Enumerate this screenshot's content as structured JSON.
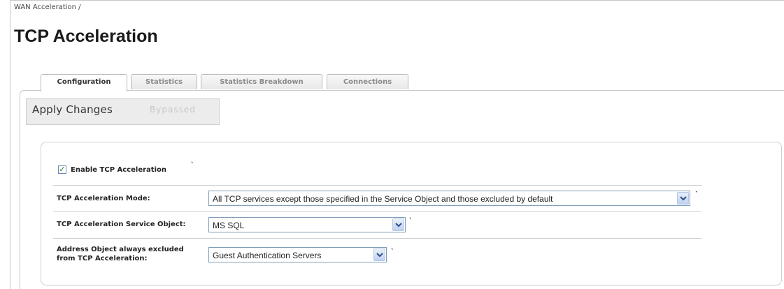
{
  "breadcrumb": "WAN Acceleration /",
  "page_title": "TCP Acceleration",
  "tabs": [
    {
      "label": "Configuration",
      "active": true
    },
    {
      "label": "Statistics",
      "active": false
    },
    {
      "label": "Statistics Breakdown",
      "active": false
    },
    {
      "label": "Connections",
      "active": false
    }
  ],
  "toolbar": {
    "apply_label": "Apply Changes",
    "bypassed_label": "Bypassed"
  },
  "settings": {
    "enable_label": "Enable TCP Acceleration",
    "enable_checked": true,
    "mode_label": "TCP Acceleration Mode:",
    "mode_value": "All TCP services except those specified in the Service Object and those excluded by default",
    "service_object_label": "TCP Acceleration Service Object:",
    "service_object_value": "MS SQL",
    "excluded_label_line1": "Address Object always excluded",
    "excluded_label_line2": "from TCP Acceleration:",
    "excluded_value": "Guest Authentication Servers"
  },
  "icons": {
    "checkbox": "checkmark-icon",
    "dropdown": "chevron-down-icon",
    "help": "help-tooltip-icon"
  }
}
